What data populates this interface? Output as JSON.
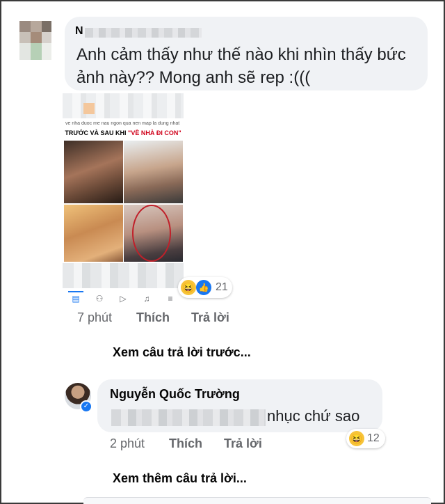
{
  "comment1": {
    "author_initial": "N",
    "text": "Anh cảm thấy như thế nào khi nhìn thấy bức ảnh này?? Mong anh sẽ rep :(((",
    "attachment": {
      "caption": "ve nha duoc me nau ngon qua nen map la dung nhat",
      "title_prefix": "TRƯỚC VÀ SAU KHI ",
      "title_highlight": "\"VỀ NHÀ ĐI CON\""
    },
    "reactions": {
      "icons": [
        "haha-emoji",
        "like-icon"
      ],
      "count": "21"
    },
    "time": "7 phút",
    "like_label": "Thích",
    "reply_label": "Trả lời"
  },
  "view_previous_replies": "Xem câu trả lời trước...",
  "reply1": {
    "author": "Nguyễn Quốc Trường",
    "text_visible": "nhục chứ sao",
    "reactions": {
      "icons": [
        "haha-emoji"
      ],
      "count": "12"
    },
    "time": "2 phút",
    "like_label": "Thích",
    "reply_label": "Trả lời"
  },
  "view_more_replies": "Xem thêm câu trả lời...",
  "colors": {
    "accent": "#1877f2",
    "bubble": "#f0f2f5",
    "meta_text": "#65676b",
    "highlight_red": "#d0021b"
  }
}
